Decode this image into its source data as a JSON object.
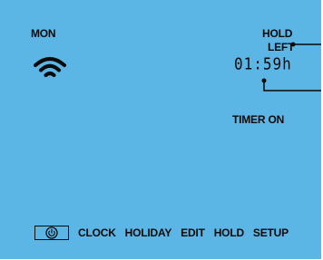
{
  "display": {
    "day": "MON",
    "mode_label": "HOLD",
    "left_label": "LEFT",
    "time": "01:59",
    "time_unit": "h",
    "timer_status": "TIMER ON",
    "background_color": "#5bb5e5"
  },
  "icons": {
    "wifi": "wifi-icon",
    "power": "power-icon"
  },
  "menu": {
    "items": [
      "CLOCK",
      "HOLIDAY",
      "EDIT",
      "HOLD",
      "SETUP"
    ]
  }
}
